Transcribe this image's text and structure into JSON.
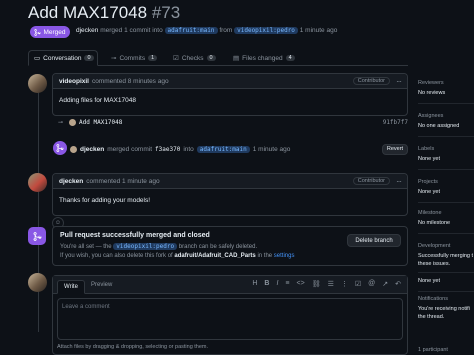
{
  "header": {
    "title": "Add MAX17048",
    "number": "#73",
    "status": "Merged",
    "author": "djecken",
    "merge_text": "merged 1 commit into",
    "base_branch": "adafruit:main",
    "from_text": "from",
    "head_branch": "videopixil:pedro",
    "time": "1 minute ago"
  },
  "tabs": [
    {
      "label": "Conversation",
      "count": "0"
    },
    {
      "label": "Commits",
      "count": "1"
    },
    {
      "label": "Checks",
      "count": "0"
    },
    {
      "label": "Files changed",
      "count": "4"
    }
  ],
  "comment1": {
    "author": "videopixil",
    "meta": "commented 8 minutes ago",
    "role": "Contributor",
    "body": "Adding files for MAX17048"
  },
  "commit": {
    "message": "Add MAX17048",
    "sha": "91fb7f7"
  },
  "merge_event": {
    "author": "djecken",
    "text": "merged commit",
    "sha": "f3ae370",
    "into": "into",
    "branch": "adafruit:main",
    "time": "1 minute ago",
    "revert": "Revert"
  },
  "comment2": {
    "author": "djecken",
    "meta": "commented 1 minute ago",
    "role": "Contributor",
    "body": "Thanks for adding your models!"
  },
  "merged_box": {
    "title": "Pull request successfully merged and closed",
    "line1_a": "You're all set — the",
    "line1_branch": "videopixil:pedro",
    "line1_b": "branch can be safely deleted.",
    "line2_a": "If you wish, you can also delete this fork of",
    "line2_repo": "adafruit/Adafruit_CAD_Parts",
    "line2_b": "in the",
    "line2_link": "settings",
    "delete_button": "Delete branch"
  },
  "editor": {
    "tab_write": "Write",
    "tab_preview": "Preview",
    "placeholder": "Leave a comment",
    "attach": "Attach files by dragging & dropping, selecting or pasting them."
  },
  "sidebar": [
    {
      "heading": "Reviewers",
      "value": "No reviews"
    },
    {
      "heading": "Assignees",
      "value": "No one assigned"
    },
    {
      "heading": "Labels",
      "value": "None yet"
    },
    {
      "heading": "Projects",
      "value": "None yet"
    },
    {
      "heading": "Milestone",
      "value": "No milestone"
    },
    {
      "heading": "Development",
      "value": "Successfully merging t",
      "value2": "these issues."
    },
    {
      "heading": "None yet",
      "value": ""
    },
    {
      "heading": "Notifications",
      "value": "You're receiving notifi",
      "value2": "the thread."
    },
    {
      "heading": "1 participant",
      "value": ""
    }
  ],
  "colors": {
    "merged": "#8957e5",
    "link": "#4493f8",
    "bg": "#0d1117"
  }
}
